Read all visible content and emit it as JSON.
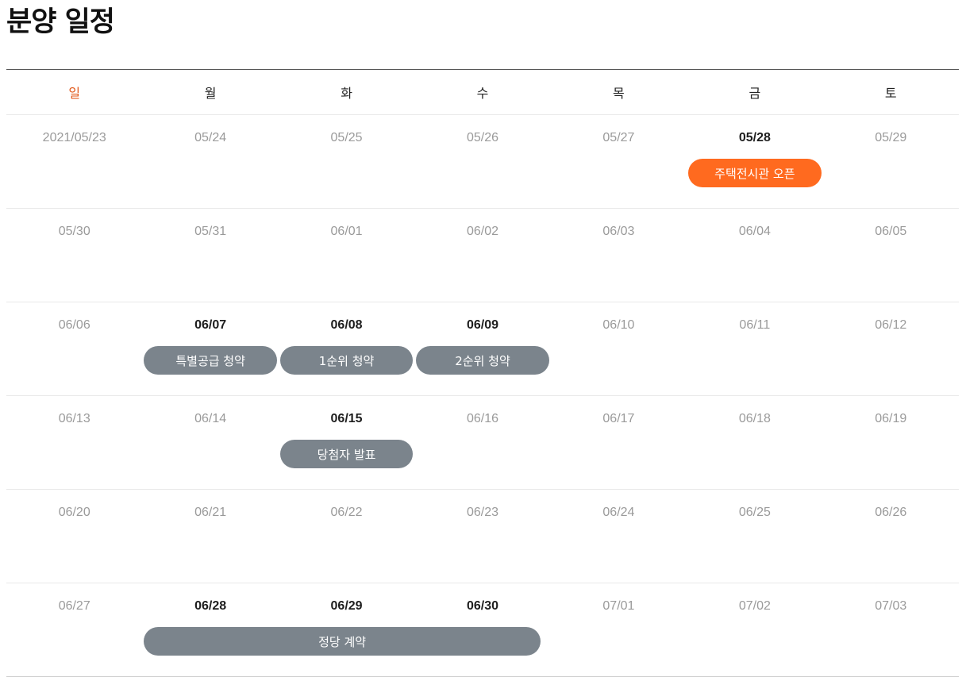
{
  "title": "분양 일정",
  "colors": {
    "accent": "#ff6a1f",
    "event_gray": "#7b848c",
    "sunday": "#e25a1c"
  },
  "weekdays": [
    "일",
    "월",
    "화",
    "수",
    "목",
    "금",
    "토"
  ],
  "weeks": [
    {
      "days": [
        {
          "label": "2021/05/23",
          "active": false
        },
        {
          "label": "05/24",
          "active": false
        },
        {
          "label": "05/25",
          "active": false
        },
        {
          "label": "05/26",
          "active": false
        },
        {
          "label": "05/27",
          "active": false
        },
        {
          "label": "05/28",
          "active": true
        },
        {
          "label": "05/29",
          "active": false
        }
      ],
      "events": [
        {
          "label": "주택전시관 오픈",
          "start": 5,
          "span": 1,
          "color": "orange"
        }
      ]
    },
    {
      "days": [
        {
          "label": "05/30",
          "active": false
        },
        {
          "label": "05/31",
          "active": false
        },
        {
          "label": "06/01",
          "active": false
        },
        {
          "label": "06/02",
          "active": false
        },
        {
          "label": "06/03",
          "active": false
        },
        {
          "label": "06/04",
          "active": false
        },
        {
          "label": "06/05",
          "active": false
        }
      ],
      "events": []
    },
    {
      "days": [
        {
          "label": "06/06",
          "active": false
        },
        {
          "label": "06/07",
          "active": true
        },
        {
          "label": "06/08",
          "active": true
        },
        {
          "label": "06/09",
          "active": true
        },
        {
          "label": "06/10",
          "active": false
        },
        {
          "label": "06/11",
          "active": false
        },
        {
          "label": "06/12",
          "active": false
        }
      ],
      "events": [
        {
          "label": "특별공급 청약",
          "start": 1,
          "span": 1,
          "color": "gray"
        },
        {
          "label": "1순위 청약",
          "start": 2,
          "span": 1,
          "color": "gray"
        },
        {
          "label": "2순위 청약",
          "start": 3,
          "span": 1,
          "color": "gray"
        }
      ]
    },
    {
      "days": [
        {
          "label": "06/13",
          "active": false
        },
        {
          "label": "06/14",
          "active": false
        },
        {
          "label": "06/15",
          "active": true
        },
        {
          "label": "06/16",
          "active": false
        },
        {
          "label": "06/17",
          "active": false
        },
        {
          "label": "06/18",
          "active": false
        },
        {
          "label": "06/19",
          "active": false
        }
      ],
      "events": [
        {
          "label": "당첨자 발표",
          "start": 2,
          "span": 1,
          "color": "gray"
        }
      ]
    },
    {
      "days": [
        {
          "label": "06/20",
          "active": false
        },
        {
          "label": "06/21",
          "active": false
        },
        {
          "label": "06/22",
          "active": false
        },
        {
          "label": "06/23",
          "active": false
        },
        {
          "label": "06/24",
          "active": false
        },
        {
          "label": "06/25",
          "active": false
        },
        {
          "label": "06/26",
          "active": false
        }
      ],
      "events": []
    },
    {
      "days": [
        {
          "label": "06/27",
          "active": false
        },
        {
          "label": "06/28",
          "active": true
        },
        {
          "label": "06/29",
          "active": true
        },
        {
          "label": "06/30",
          "active": true
        },
        {
          "label": "07/01",
          "active": false
        },
        {
          "label": "07/02",
          "active": false
        },
        {
          "label": "07/03",
          "active": false
        }
      ],
      "events": [
        {
          "label": "정당 계약",
          "start": 1,
          "span": 3,
          "color": "gray"
        }
      ]
    }
  ]
}
